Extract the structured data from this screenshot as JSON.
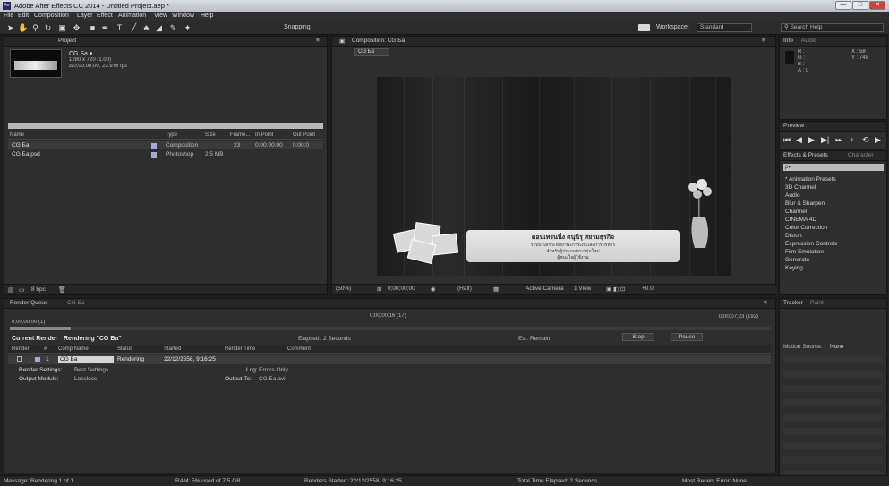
{
  "window": {
    "title": "Adobe After Effects CC 2014 - Untitled Project.aep *",
    "app_icon": "Ae",
    "minimize": "—",
    "maximize": "□",
    "close": "✕"
  },
  "menu": [
    "File",
    "Edit",
    "Composition",
    "Layer",
    "Effect",
    "Animation",
    "View",
    "Window",
    "Help"
  ],
  "toolbar": {
    "tools": [
      "selection-tool",
      "hand-tool",
      "zoom-tool",
      "rotation-tool",
      "camera-tool",
      "pan-behind-tool",
      "mask-tool",
      "pen-tool",
      "text-tool",
      "brush-tool",
      "clone-tool",
      "eraser-tool",
      "roto-tool",
      "puppet-tool"
    ],
    "snapping_label": "Snapping",
    "workspace_label": "Workspace:",
    "workspace_value": "Standard",
    "search_placeholder": "Search Help"
  },
  "project_panel": {
    "tab_project": "Project",
    "comp_name": "CG Ба ▾",
    "comp_size": "1280 x 720 (1.00)",
    "comp_duration": "Δ 0;00;08;00, 23.976 fps",
    "columns": [
      "Name",
      "Type",
      "Size",
      "Frame...",
      "In Point",
      "Out Point"
    ],
    "items": [
      {
        "name": "CG Ба",
        "type": "Composition",
        "size": "",
        "frame": "23",
        "in_point": "0:00:00:00",
        "out_point": "0:00:0"
      },
      {
        "name": "CG Ба.psd",
        "type": "Photoshop",
        "size": "2.5 MB",
        "frame": "",
        "in_point": "",
        "out_point": ""
      }
    ],
    "footer_bpc": "8 bpc"
  },
  "comp_panel": {
    "tab": "Composition: CG Ба",
    "sub_tab": "CG Ба",
    "banner_line1": "ดอนเทรนนิ่ง ตนุนิรุ สยามธุรกิจ",
    "banner_line2": "ระบบวิเคราะห์สถานะการเงินและการบริหาร",
    "banner_line3": "สำหรับผู้ประกอบการรุ่นใหม่",
    "banner_line4": "ผู้ชนะใจผู้ใช้งาน",
    "zoom": "(50%)",
    "timecode": "0;00;00;00",
    "resolution": "(Half)",
    "camera": "Active Camera",
    "views": "1 View",
    "offset": "+0.0"
  },
  "info_panel": {
    "tab_info": "Info",
    "tab_audio": "Audio",
    "r": "R :",
    "g": "G :",
    "b": "B :",
    "a": "A : 0",
    "x": "X : 58",
    "y": "Y : 748"
  },
  "preview_panel": {
    "tab": "Preview",
    "controls": [
      "first-frame",
      "previous-frame",
      "play",
      "next-frame",
      "last-frame",
      "audio",
      "loop",
      "ram-preview"
    ]
  },
  "effects_panel": {
    "tab": "Effects & Presets",
    "tab2": "Character",
    "search_placeholder": "ρ▾",
    "items": [
      "* Animation Presets",
      "3D Channel",
      "Audio",
      "Blur & Sharpen",
      "Channel",
      "CINEMA 4D",
      "Color Correction",
      "Distort",
      "Expression Controls",
      "Film Emulation",
      "Generate",
      "Keying"
    ]
  },
  "tracker_panel": {
    "tab": "Tracker",
    "tab2": "Paint",
    "motion_source_label": "Motion Source:",
    "motion_source_value": "None"
  },
  "render_queue": {
    "tab": "Render Queue",
    "tab2": "CG Ба",
    "elapsed_time": "0;00;00;00 (1)",
    "mid_time": "0;00;00;16 (17)",
    "end_time": "0;00;07;23 (192)",
    "current_render_label": "Current Render",
    "rendering_label": "Rendering \"CG Ба\"",
    "elapsed_label": "Elapsed:",
    "elapsed_value": "2 Seconds",
    "remain_label": "Est. Remain:",
    "stop_label": "Stop",
    "pause_label": "Pause",
    "columns": [
      "Render",
      "#",
      "Comp Name",
      "Status",
      "Started",
      "Render Time",
      "Comment"
    ],
    "row": {
      "num": "1",
      "comp": "CG Ба",
      "status": "Rendering",
      "started": "22/12/2558, 9:16:25"
    },
    "render_settings_label": "Render Settings:",
    "render_settings_value": "Best Settings",
    "log_label": "Log:",
    "log_value": "Errors Only",
    "output_module_label": "Output Module:",
    "output_module_value": "Lossless",
    "output_to_label": "Output To:",
    "output_to_value": "CG Ба.avi"
  },
  "status_bar": {
    "message": "Message: Rendering 1 of 1",
    "ram": "RAM: 5% used of 7.5 GB",
    "renders_started": "Renders Started: 22/12/2558, 9:16:25",
    "total_elapsed": "Total Time Elapsed: 2 Seconds",
    "recent_error": "Most Recent Error: None"
  }
}
